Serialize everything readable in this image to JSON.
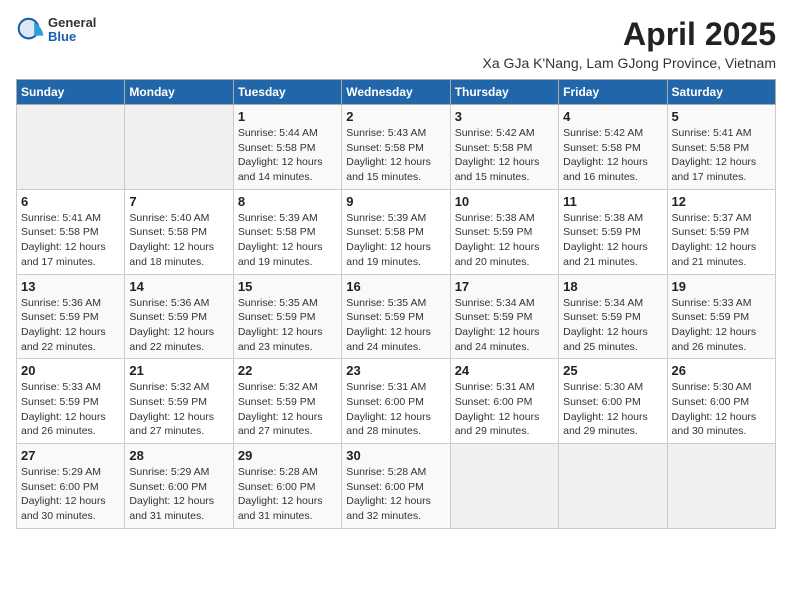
{
  "logo": {
    "general": "General",
    "blue": "Blue"
  },
  "title": "April 2025",
  "location": "Xa GJa K'Nang, Lam GJong Province, Vietnam",
  "days_of_week": [
    "Sunday",
    "Monday",
    "Tuesday",
    "Wednesday",
    "Thursday",
    "Friday",
    "Saturday"
  ],
  "weeks": [
    [
      {
        "day": "",
        "info": ""
      },
      {
        "day": "",
        "info": ""
      },
      {
        "day": "1",
        "info": "Sunrise: 5:44 AM\nSunset: 5:58 PM\nDaylight: 12 hours and 14 minutes."
      },
      {
        "day": "2",
        "info": "Sunrise: 5:43 AM\nSunset: 5:58 PM\nDaylight: 12 hours and 15 minutes."
      },
      {
        "day": "3",
        "info": "Sunrise: 5:42 AM\nSunset: 5:58 PM\nDaylight: 12 hours and 15 minutes."
      },
      {
        "day": "4",
        "info": "Sunrise: 5:42 AM\nSunset: 5:58 PM\nDaylight: 12 hours and 16 minutes."
      },
      {
        "day": "5",
        "info": "Sunrise: 5:41 AM\nSunset: 5:58 PM\nDaylight: 12 hours and 17 minutes."
      }
    ],
    [
      {
        "day": "6",
        "info": "Sunrise: 5:41 AM\nSunset: 5:58 PM\nDaylight: 12 hours and 17 minutes."
      },
      {
        "day": "7",
        "info": "Sunrise: 5:40 AM\nSunset: 5:58 PM\nDaylight: 12 hours and 18 minutes."
      },
      {
        "day": "8",
        "info": "Sunrise: 5:39 AM\nSunset: 5:58 PM\nDaylight: 12 hours and 19 minutes."
      },
      {
        "day": "9",
        "info": "Sunrise: 5:39 AM\nSunset: 5:58 PM\nDaylight: 12 hours and 19 minutes."
      },
      {
        "day": "10",
        "info": "Sunrise: 5:38 AM\nSunset: 5:59 PM\nDaylight: 12 hours and 20 minutes."
      },
      {
        "day": "11",
        "info": "Sunrise: 5:38 AM\nSunset: 5:59 PM\nDaylight: 12 hours and 21 minutes."
      },
      {
        "day": "12",
        "info": "Sunrise: 5:37 AM\nSunset: 5:59 PM\nDaylight: 12 hours and 21 minutes."
      }
    ],
    [
      {
        "day": "13",
        "info": "Sunrise: 5:36 AM\nSunset: 5:59 PM\nDaylight: 12 hours and 22 minutes."
      },
      {
        "day": "14",
        "info": "Sunrise: 5:36 AM\nSunset: 5:59 PM\nDaylight: 12 hours and 22 minutes."
      },
      {
        "day": "15",
        "info": "Sunrise: 5:35 AM\nSunset: 5:59 PM\nDaylight: 12 hours and 23 minutes."
      },
      {
        "day": "16",
        "info": "Sunrise: 5:35 AM\nSunset: 5:59 PM\nDaylight: 12 hours and 24 minutes."
      },
      {
        "day": "17",
        "info": "Sunrise: 5:34 AM\nSunset: 5:59 PM\nDaylight: 12 hours and 24 minutes."
      },
      {
        "day": "18",
        "info": "Sunrise: 5:34 AM\nSunset: 5:59 PM\nDaylight: 12 hours and 25 minutes."
      },
      {
        "day": "19",
        "info": "Sunrise: 5:33 AM\nSunset: 5:59 PM\nDaylight: 12 hours and 26 minutes."
      }
    ],
    [
      {
        "day": "20",
        "info": "Sunrise: 5:33 AM\nSunset: 5:59 PM\nDaylight: 12 hours and 26 minutes."
      },
      {
        "day": "21",
        "info": "Sunrise: 5:32 AM\nSunset: 5:59 PM\nDaylight: 12 hours and 27 minutes."
      },
      {
        "day": "22",
        "info": "Sunrise: 5:32 AM\nSunset: 5:59 PM\nDaylight: 12 hours and 27 minutes."
      },
      {
        "day": "23",
        "info": "Sunrise: 5:31 AM\nSunset: 6:00 PM\nDaylight: 12 hours and 28 minutes."
      },
      {
        "day": "24",
        "info": "Sunrise: 5:31 AM\nSunset: 6:00 PM\nDaylight: 12 hours and 29 minutes."
      },
      {
        "day": "25",
        "info": "Sunrise: 5:30 AM\nSunset: 6:00 PM\nDaylight: 12 hours and 29 minutes."
      },
      {
        "day": "26",
        "info": "Sunrise: 5:30 AM\nSunset: 6:00 PM\nDaylight: 12 hours and 30 minutes."
      }
    ],
    [
      {
        "day": "27",
        "info": "Sunrise: 5:29 AM\nSunset: 6:00 PM\nDaylight: 12 hours and 30 minutes."
      },
      {
        "day": "28",
        "info": "Sunrise: 5:29 AM\nSunset: 6:00 PM\nDaylight: 12 hours and 31 minutes."
      },
      {
        "day": "29",
        "info": "Sunrise: 5:28 AM\nSunset: 6:00 PM\nDaylight: 12 hours and 31 minutes."
      },
      {
        "day": "30",
        "info": "Sunrise: 5:28 AM\nSunset: 6:00 PM\nDaylight: 12 hours and 32 minutes."
      },
      {
        "day": "",
        "info": ""
      },
      {
        "day": "",
        "info": ""
      },
      {
        "day": "",
        "info": ""
      }
    ]
  ]
}
